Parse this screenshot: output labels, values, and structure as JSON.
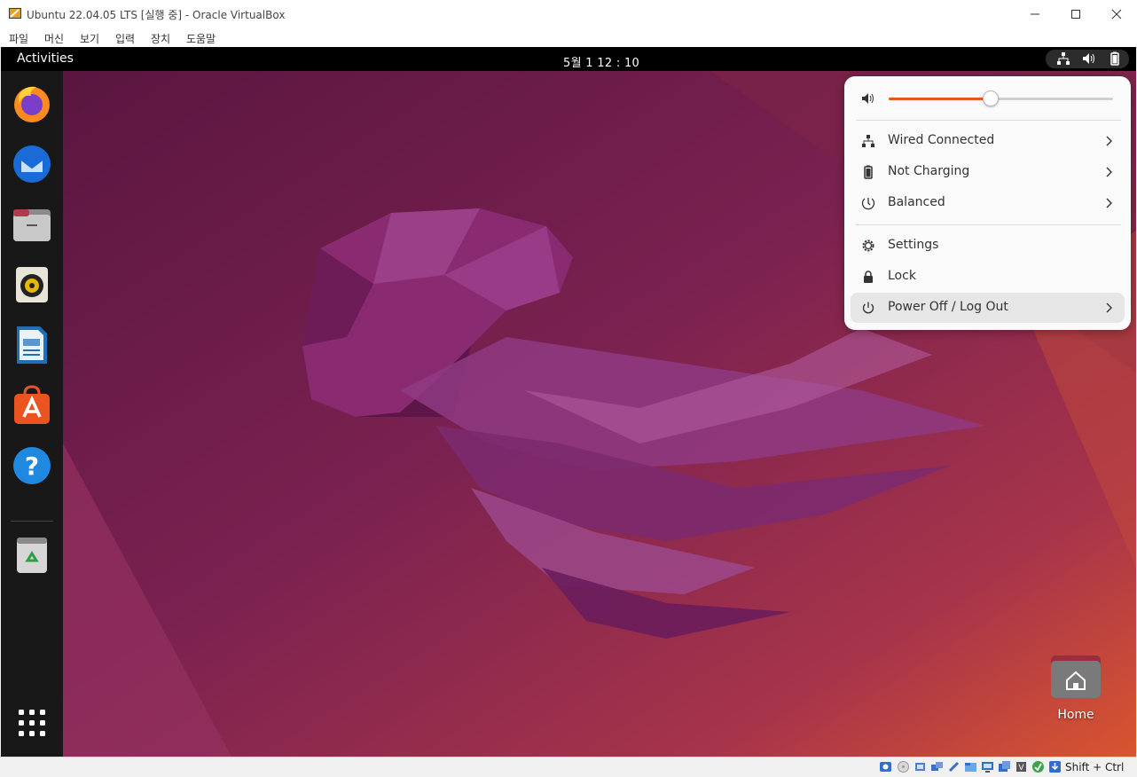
{
  "window": {
    "title": "Ubuntu 22.04.05 LTS [실행 중] - Oracle VirtualBox",
    "menu": [
      "파일",
      "머신",
      "보기",
      "입력",
      "장치",
      "도움말"
    ]
  },
  "topbar": {
    "activities": "Activities",
    "clock": "5월 1  12 : 10",
    "tray_icons": [
      "network-icon",
      "volume-icon",
      "battery-icon"
    ]
  },
  "dock": {
    "items": [
      "firefox",
      "thunderbird",
      "files",
      "rhythmbox",
      "libreoffice-writer",
      "ubuntu-software",
      "help",
      "trash"
    ],
    "show_apps": "show-apps-icon"
  },
  "desktop": {
    "home_label": "Home"
  },
  "quick_settings": {
    "volume_level": 0.45,
    "rows": {
      "network": "Wired Connected",
      "battery": "Not Charging",
      "power_mode": "Balanced",
      "settings": "Settings",
      "lock": "Lock",
      "power": "Power Off / Log Out"
    }
  },
  "status_bar": {
    "host_key": "Shift + Ctrl"
  },
  "colors": {
    "accent": "#e95420",
    "topbar": "#000000",
    "dock": "#181818",
    "wallpaper": "#6b1b4b"
  }
}
